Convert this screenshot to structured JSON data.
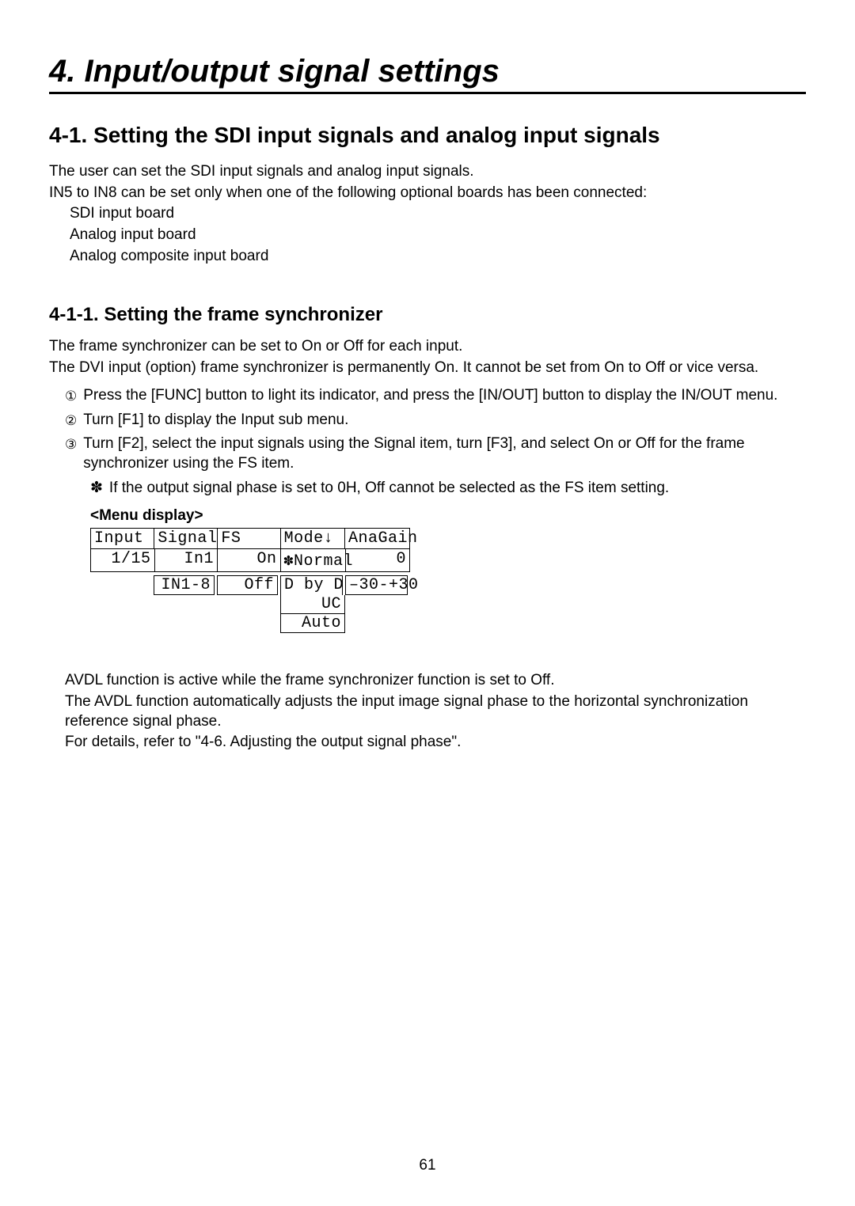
{
  "chapter_title": "4. Input/output signal settings",
  "section_title": "4-1. Setting the SDI input signals and analog input signals",
  "intro": {
    "p1": "The user can set the SDI input signals and analog input signals.",
    "p2": "IN5 to IN8 can be set only when one of the following optional boards has been connected:",
    "items": [
      "SDI input board",
      "Analog input board",
      "Analog composite input board"
    ]
  },
  "subsection_title": "4-1-1. Setting the frame synchronizer",
  "fs": {
    "p1": "The frame synchronizer can be set to On or Off for each input.",
    "p2": "The DVI input (option) frame synchronizer is permanently On. It cannot be set from On to Off or vice versa.",
    "steps": [
      "Press the [FUNC] button to light its indicator, and press the [IN/OUT] button to display the IN/OUT menu.",
      "Turn [F1] to display the Input sub menu.",
      "Turn [F2], select the input signals using the Signal item, turn [F3], and select On or Off for the frame synchronizer using the FS item."
    ],
    "note_symbol": "✽",
    "note": "If the output signal phase is set to 0H, Off cannot be selected as the FS item setting."
  },
  "menu_label": "<Menu display>",
  "menu": {
    "headers": [
      "Input",
      "Signal",
      "FS",
      "Mode↓",
      "AnaGain"
    ],
    "values": [
      "1/15",
      "In1",
      "On",
      "✽Normal",
      "0"
    ],
    "ranges": [
      "IN1-8",
      "Off",
      "D by D",
      "–30-+30"
    ],
    "mode_extra": [
      "UC",
      "Auto"
    ]
  },
  "avdl": {
    "p1": "AVDL function is active while the frame synchronizer function is set to Off.",
    "p2": "The AVDL function automatically adjusts the input image signal phase to the horizontal synchronization reference signal phase.",
    "p3": "For details, refer to \"4-6. Adjusting the output signal phase\"."
  },
  "page_number": "61"
}
